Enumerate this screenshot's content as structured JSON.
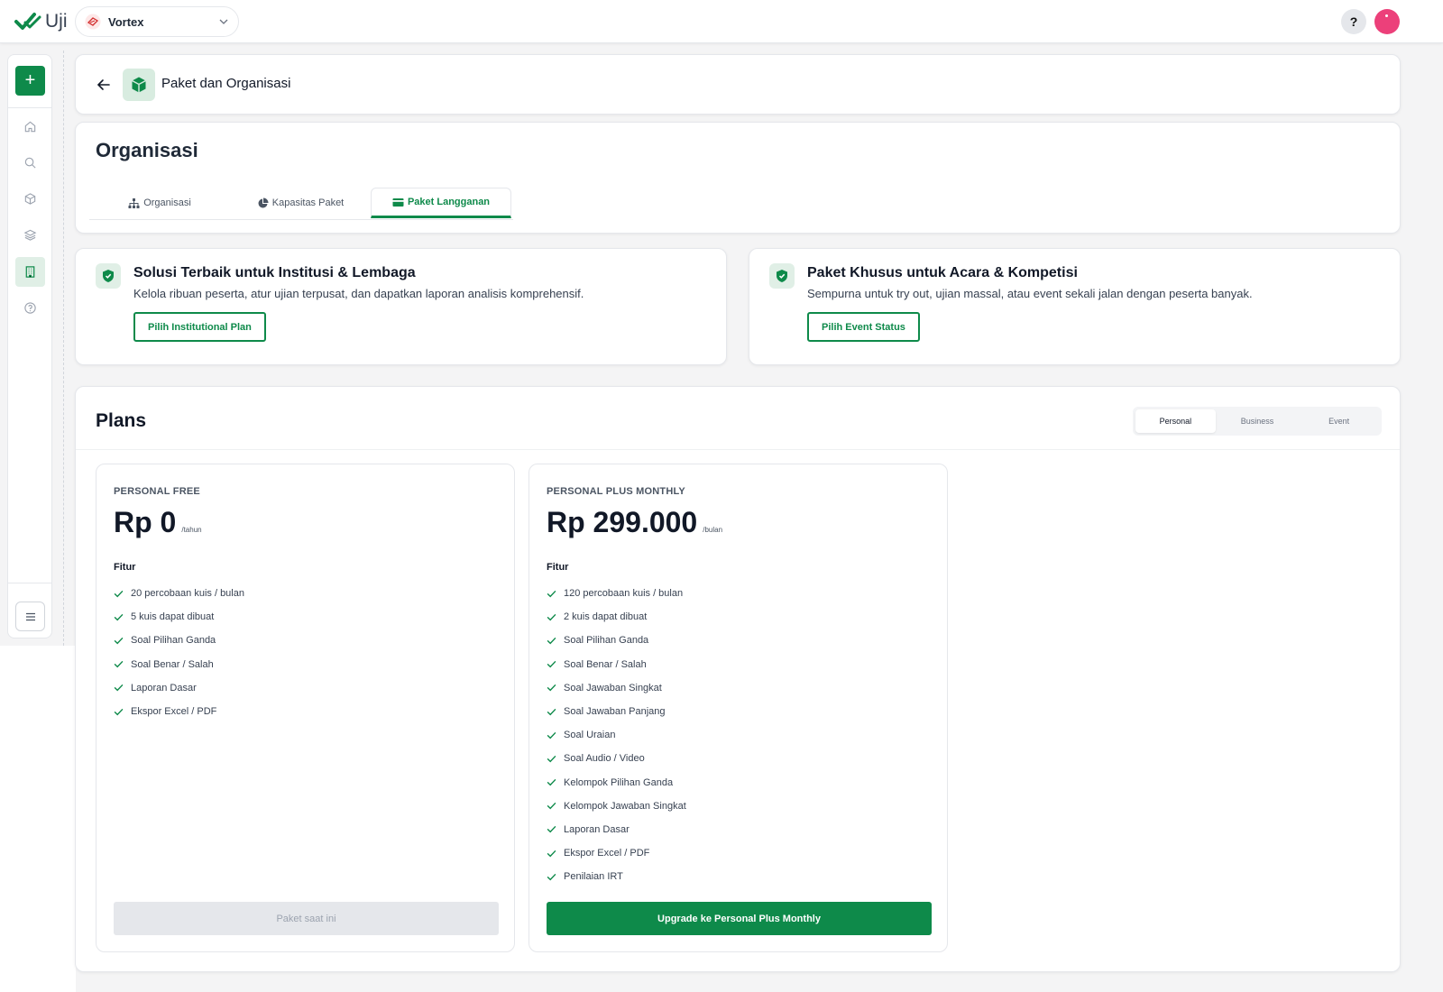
{
  "topbar": {
    "app_name": "Uji",
    "org_name": "Vortex",
    "help_label": "?"
  },
  "sidebar": {
    "add_label": "+",
    "items": [
      {
        "icon": "home-icon"
      },
      {
        "icon": "search-icon"
      },
      {
        "icon": "cube-icon"
      },
      {
        "icon": "layers-icon"
      },
      {
        "icon": "building-icon",
        "active": true
      },
      {
        "icon": "help-circle-icon"
      }
    ]
  },
  "header": {
    "title": "Paket dan Organisasi"
  },
  "organization": {
    "title": "Organisasi",
    "tabs": [
      {
        "label": "Organisasi",
        "icon": "sitemap-icon"
      },
      {
        "label": "Kapasitas Paket",
        "icon": "pie-chart-icon"
      },
      {
        "label": "Paket Langganan",
        "icon": "credit-card-icon",
        "active": true
      }
    ]
  },
  "promos": [
    {
      "title": "Solusi Terbaik untuk Institusi & Lembaga",
      "description": "Kelola ribuan peserta, atur ujian terpusat, dan dapatkan laporan analisis komprehensif.",
      "button": "Pilih Institutional Plan"
    },
    {
      "title": "Paket Khusus untuk Acara & Kompetisi",
      "description": "Sempurna untuk try out, ujian massal, atau event sekali jalan dengan peserta banyak.",
      "button": "Pilih Event Status"
    }
  ],
  "plans": {
    "title": "Plans",
    "segments": [
      {
        "label": "Personal",
        "active": true
      },
      {
        "label": "Business"
      },
      {
        "label": "Event"
      }
    ],
    "features_heading": "Fitur",
    "items": [
      {
        "name": "PERSONAL FREE",
        "price": "Rp 0",
        "period": "/tahun",
        "features": [
          "20 percobaan kuis / bulan",
          "5 kuis dapat dibuat",
          "Soal Pilihan Ganda",
          "Soal Benar / Salah",
          "Laporan Dasar",
          "Ekspor Excel / PDF"
        ],
        "button": "Paket saat ini"
      },
      {
        "name": "PERSONAL PLUS MONTHLY",
        "price": "Rp 299.000",
        "period": "/bulan",
        "features": [
          "120 percobaan kuis / bulan",
          "2 kuis dapat dibuat",
          "Soal Pilihan Ganda",
          "Soal Benar / Salah",
          "Soal Jawaban Singkat",
          "Soal Jawaban Panjang",
          "Soal Uraian",
          "Soal Audio / Video",
          "Kelompok Pilihan Ganda",
          "Kelompok Jawaban Singkat",
          "Laporan Dasar",
          "Ekspor Excel / PDF",
          "Penilaian IRT"
        ],
        "button": "Upgrade ke Personal Plus Monthly"
      }
    ]
  },
  "colors": {
    "brand": "#0e8a4a",
    "avatar": "#ec407a"
  }
}
